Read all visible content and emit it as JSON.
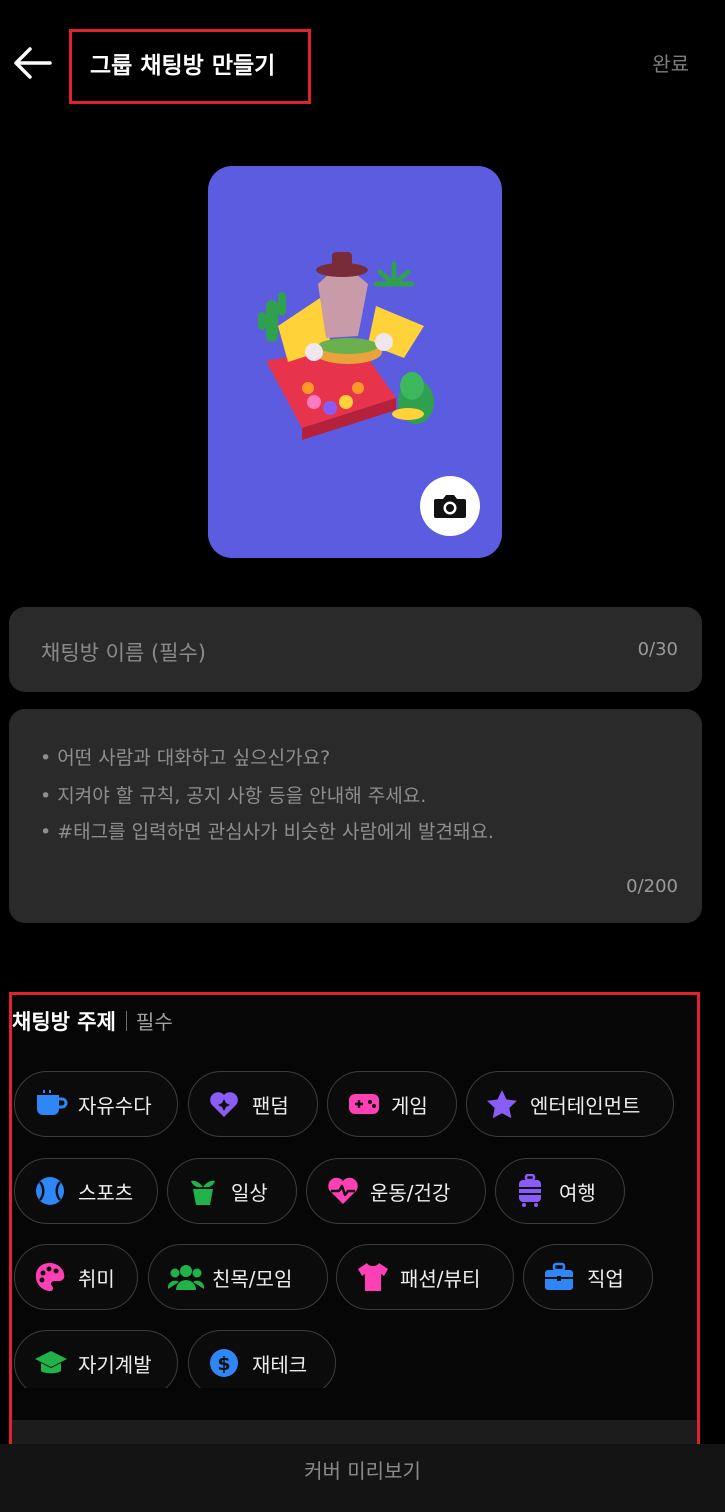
{
  "header": {
    "title": "그룹 채팅방 만들기",
    "done_label": "완료"
  },
  "colors": {
    "background": "#000000",
    "cover": "#5c5ce0",
    "field": "#2a2a2a",
    "highlight": "#e2222a"
  },
  "name_field": {
    "placeholder": "채팅방 이름 (필수)",
    "counter": "0/30"
  },
  "description_field": {
    "lines": [
      "• 어떤 사람과 대화하고 싶으신가요?",
      "• 지켜야 할 규칙, 공지 사항 등을 안내해 주세요.",
      "• #태그를 입력하면 관심사가 비슷한 사람에게 발견돼요."
    ],
    "counter": "0/200"
  },
  "topics": {
    "title": "채팅방 주제",
    "required_label": "필수",
    "chips": [
      {
        "label": "자유수다",
        "icon": "coffee-cup-icon",
        "color": "#2e86f7"
      },
      {
        "label": "팬덤",
        "icon": "heart-sparkle-icon",
        "color": "#8a5cf6"
      },
      {
        "label": "게임",
        "icon": "gamepad-icon",
        "color": "#ff3fb4"
      },
      {
        "label": "엔터테인먼트",
        "icon": "star-icon",
        "color": "#8a5cf6"
      },
      {
        "label": "스포츠",
        "icon": "ball-icon",
        "color": "#2e86f7"
      },
      {
        "label": "일상",
        "icon": "plant-pot-icon",
        "color": "#1fb34a"
      },
      {
        "label": "운동/건강",
        "icon": "heartbeat-icon",
        "color": "#ff3fb4"
      },
      {
        "label": "여행",
        "icon": "luggage-icon",
        "color": "#8a5cf6"
      },
      {
        "label": "취미",
        "icon": "palette-icon",
        "color": "#ff3fb4"
      },
      {
        "label": "친목/모임",
        "icon": "people-icon",
        "color": "#1fb34a"
      },
      {
        "label": "패션/뷰티",
        "icon": "shirt-icon",
        "color": "#ff3fb4"
      },
      {
        "label": "직업",
        "icon": "briefcase-icon",
        "color": "#2e86f7"
      },
      {
        "label": "자기계발",
        "icon": "graduation-cap-icon",
        "color": "#1fb34a"
      },
      {
        "label": "재테크",
        "icon": "dollar-coin-icon",
        "color": "#2e86f7"
      }
    ]
  },
  "footer": {
    "preview_label": "커버 미리보기"
  }
}
